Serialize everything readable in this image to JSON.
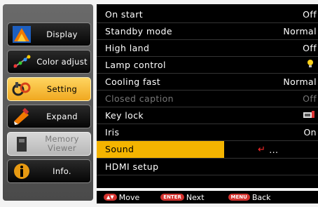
{
  "sidebar": {
    "items": [
      {
        "label": "Display",
        "icon": "display-icon",
        "state": "normal"
      },
      {
        "label": "Color adjust",
        "icon": "color-adjust-icon",
        "state": "normal"
      },
      {
        "label": "Setting",
        "icon": "setting-icon",
        "state": "active"
      },
      {
        "label": "Expand",
        "icon": "expand-icon",
        "state": "normal"
      },
      {
        "label": "Memory\nViewer",
        "icon": "memory-viewer-icon",
        "state": "disabled"
      },
      {
        "label": "Info.",
        "icon": "info-icon",
        "state": "normal"
      }
    ]
  },
  "menu": {
    "rows": [
      {
        "name": "On start",
        "value": "Off"
      },
      {
        "name": "Standby mode",
        "value": "Normal"
      },
      {
        "name": "High land",
        "value": "Off"
      },
      {
        "name": "Lamp control",
        "value": "",
        "value_icon": "lamp-bulb-icon"
      },
      {
        "name": "Cooling fast",
        "value": "Normal"
      },
      {
        "name": "Closed caption",
        "value": "Off",
        "disabled": true
      },
      {
        "name": "Key lock",
        "value": "",
        "value_icon": "key-lock-icon"
      },
      {
        "name": "Iris",
        "value": "On"
      },
      {
        "name": "Sound",
        "value": "...",
        "value_icon": "enter-arrow-icon",
        "selected": true
      },
      {
        "name": "HDMI setup",
        "value": ""
      }
    ]
  },
  "footer": {
    "move": "Move",
    "next": "Next",
    "back": "Back",
    "enter_key": "ENTER",
    "menu_key": "MENU"
  },
  "colors": {
    "highlight": "#f4b400",
    "key_badge": "#d4322e"
  }
}
